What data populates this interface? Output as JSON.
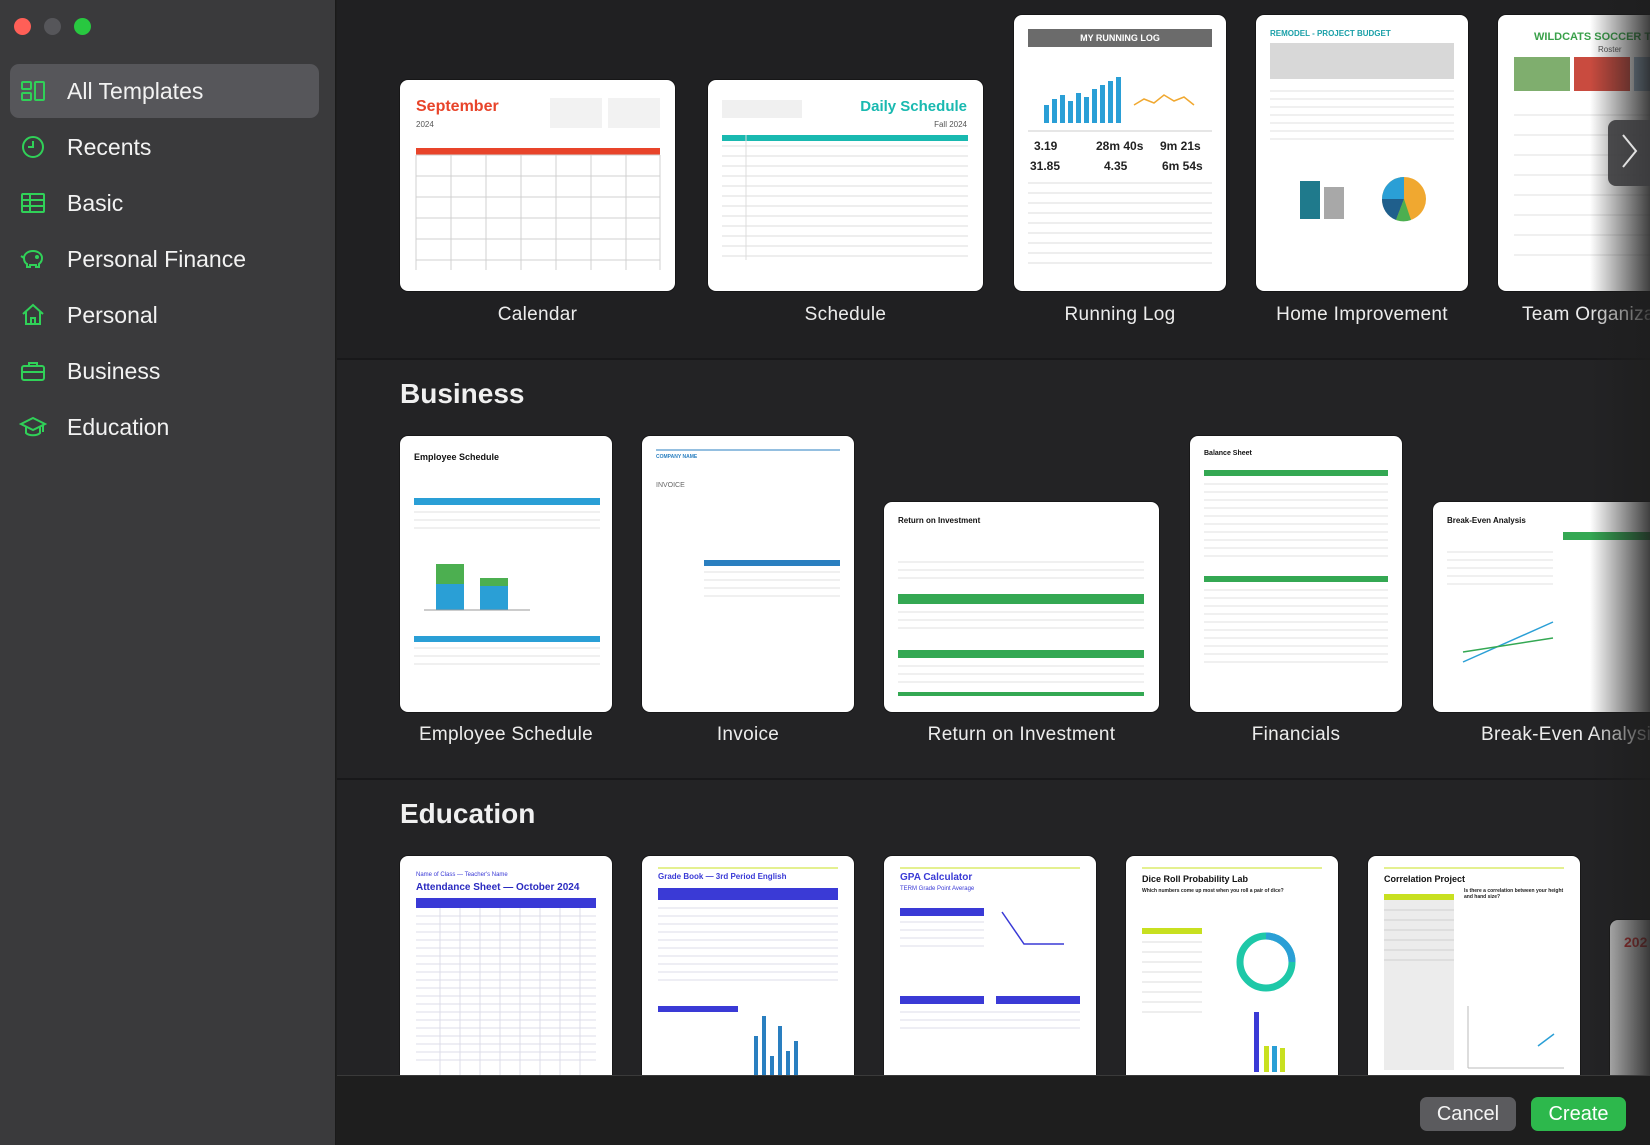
{
  "window": {
    "traffic_lights": [
      "close",
      "minimize",
      "zoom"
    ]
  },
  "colors": {
    "accent": "#30d158",
    "sidebar_bg": "#3a3a3c",
    "active_item": "#56565a",
    "create": "#2db84c"
  },
  "sidebar": {
    "items": [
      {
        "label": "All Templates",
        "icon": "all-templates-icon"
      },
      {
        "label": "Recents",
        "icon": "clock-icon"
      },
      {
        "label": "Basic",
        "icon": "table-icon"
      },
      {
        "label": "Personal Finance",
        "icon": "piggy-bank-icon"
      },
      {
        "label": "Personal",
        "icon": "house-icon"
      },
      {
        "label": "Business",
        "icon": "briefcase-icon"
      },
      {
        "label": "Education",
        "icon": "graduation-cap-icon"
      }
    ]
  },
  "personal_row": {
    "templates": [
      {
        "label": "Calendar",
        "thumb_title": "September",
        "thumb_sub": "2024"
      },
      {
        "label": "Schedule",
        "thumb_title": "Daily Schedule",
        "thumb_sub": "Fall 2024"
      },
      {
        "label": "Running Log",
        "thumb_title": "MY RUNNING LOG",
        "stats": [
          "3.19",
          "28m 40s",
          "9m 21s",
          "31.85",
          "4.35",
          "6m 54s"
        ]
      },
      {
        "label": "Home Improvement",
        "thumb_title": "REMODEL - PROJECT BUDGET"
      },
      {
        "label": "Team Organiza",
        "thumb_title": "WILDCATS SOCCER T",
        "thumb_sub": "Roster"
      }
    ]
  },
  "business": {
    "title": "Business",
    "templates": [
      {
        "label": "Employee Schedule",
        "thumb_title": "Employee Schedule"
      },
      {
        "label": "Invoice",
        "thumb_title": "COMPANY NAME",
        "thumb_sub": "INVOICE"
      },
      {
        "label": "Return on Investment",
        "thumb_title": "Return on Investment"
      },
      {
        "label": "Financials",
        "thumb_title": "Balance Sheet"
      },
      {
        "label": "Break-Even Analysi",
        "thumb_title": "Break-Even Analysis"
      }
    ]
  },
  "education": {
    "title": "Education",
    "templates": [
      {
        "thumb_title": "Attendance Sheet — October 2024",
        "thumb_sub": "Name of Class — Teacher's Name"
      },
      {
        "thumb_title": "Grade Book — 3rd Period English"
      },
      {
        "thumb_title": "GPA Calculator",
        "thumb_sub": "TERM Grade Point Average"
      },
      {
        "thumb_title": "Dice Roll Probability Lab",
        "thumb_sub": "Which numbers come up most when you roll a pair of dice?"
      },
      {
        "thumb_title": "Correlation Project",
        "thumb_sub": "Is there a correlation between your height and hand size?"
      },
      {
        "thumb_title": "202"
      }
    ]
  },
  "footer": {
    "cancel": "Cancel",
    "create": "Create"
  }
}
